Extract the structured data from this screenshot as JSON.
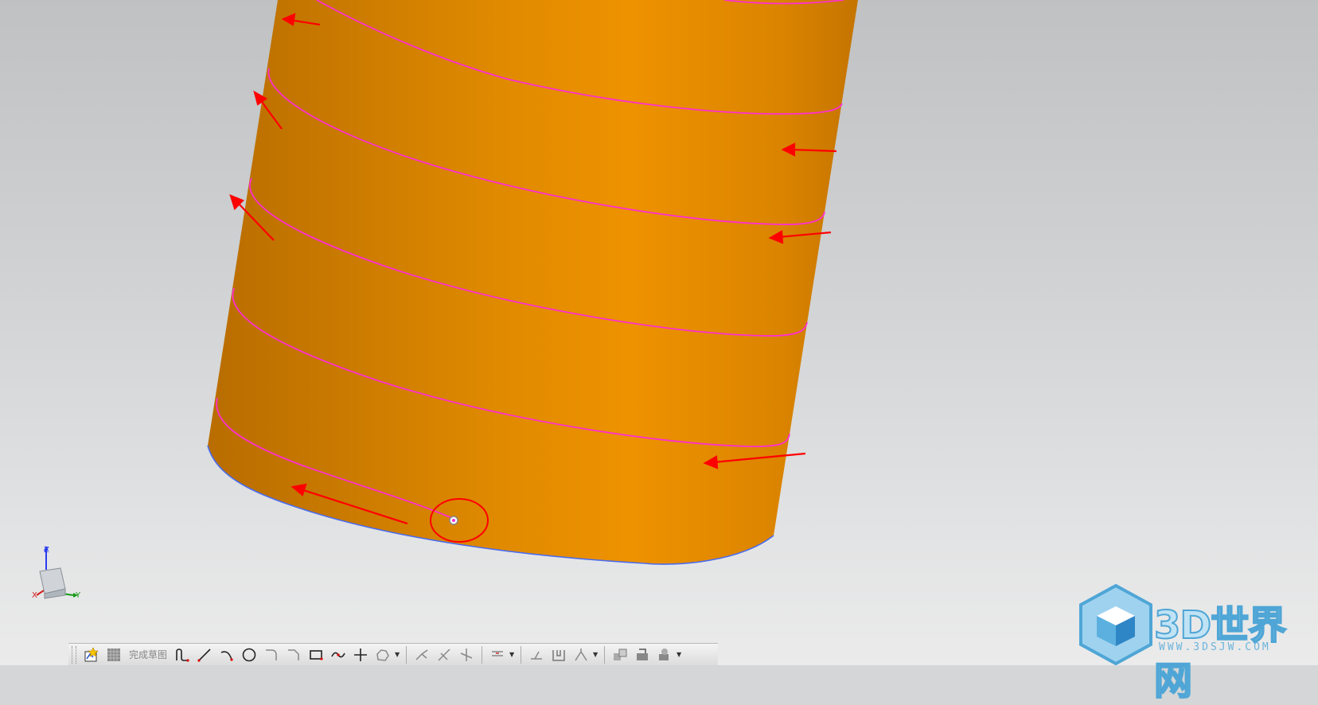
{
  "viewport": {
    "background_top": "#bfc1c3",
    "background_bottom": "#ebebeb",
    "model_color": "#e38a00",
    "curve_color": "#ff2fd0",
    "edge_color": "#4a6cf0",
    "annotation_color": "#ff0000"
  },
  "triad": {
    "z_label": "Z",
    "y_label": "Y",
    "x_label": "X"
  },
  "toolbar": {
    "finish_sketch_label": "完成草图",
    "buttons": [
      "sketch-icon",
      "orient-view-icon",
      "profile-icon",
      "line-icon",
      "arc-icon",
      "circle-icon",
      "fillet-icon",
      "chamfer-icon",
      "rectangle-icon",
      "polygon-icon",
      "point-icon",
      "studio-spline-icon",
      "quick-trim-icon",
      "quick-extend-icon",
      "corner-icon",
      "offset-curve-icon",
      "pattern-curve-icon",
      "mirror-curve-icon",
      "constraint-icon",
      "display-constraint-icon",
      "animate-icon"
    ]
  },
  "watermark": {
    "title": "3D世界网",
    "url": "WWW.3DSJW.COM"
  }
}
